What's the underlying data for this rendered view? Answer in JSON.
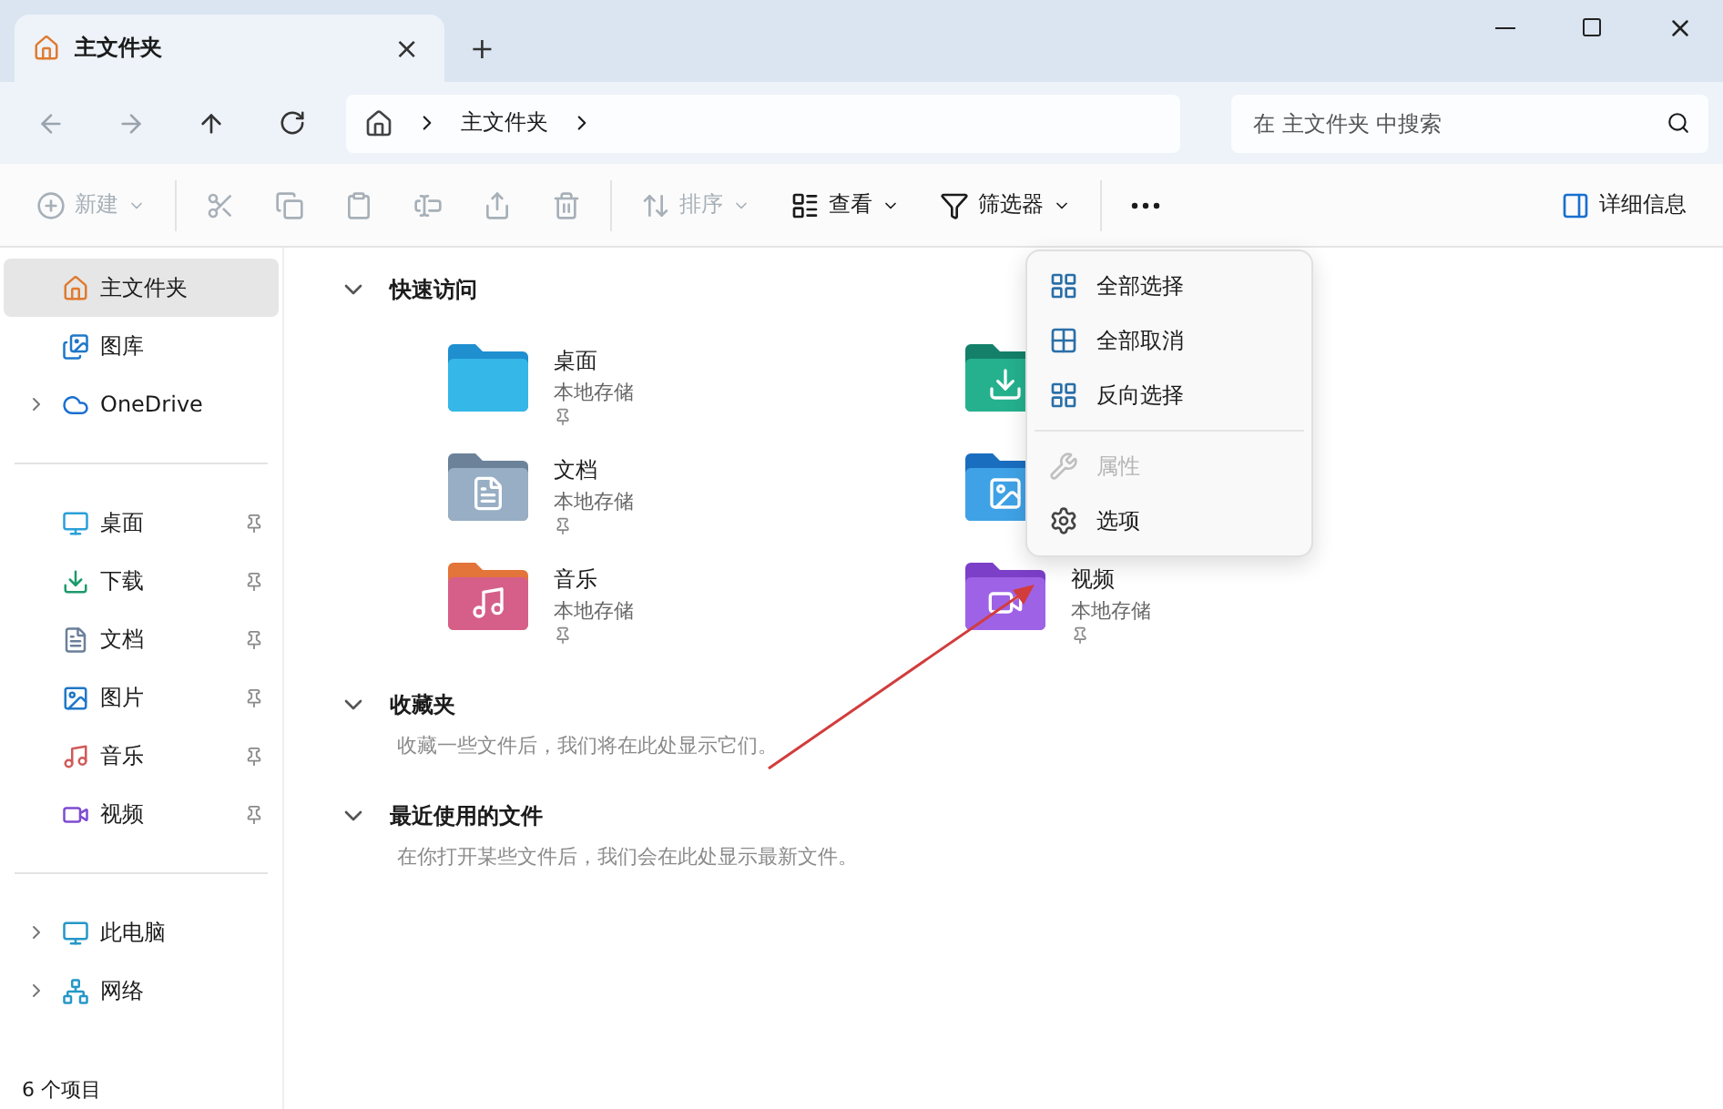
{
  "tab": {
    "title": "主文件夹",
    "close": "×",
    "new": "+"
  },
  "window_controls": [
    {
      "kind": "minimize"
    },
    {
      "kind": "maximize"
    },
    {
      "kind": "close"
    }
  ],
  "nav": {
    "breadcrumb": [
      "主文件夹"
    ],
    "search": {
      "placeholder": "在 主文件夹 中搜索"
    }
  },
  "toolbar": [
    {
      "kind": "new",
      "label": "新建",
      "disabled": true,
      "caret": true
    },
    {
      "kind": "cut",
      "disabled": true
    },
    {
      "kind": "copy",
      "disabled": true
    },
    {
      "kind": "paste",
      "disabled": true
    },
    {
      "kind": "rename",
      "disabled": true
    },
    {
      "kind": "share",
      "disabled": true
    },
    {
      "kind": "delete",
      "disabled": true
    },
    {
      "kind": "sort",
      "label": "排序",
      "disabled": true,
      "caret": true
    },
    {
      "kind": "view",
      "label": "查看",
      "disabled": false,
      "caret": true
    },
    {
      "kind": "filter",
      "label": "筛选器",
      "disabled": false,
      "caret": true
    },
    {
      "kind": "more",
      "disabled": false
    }
  ],
  "details": {
    "label": "详细信息"
  },
  "sidebar": {
    "top": [
      {
        "kind": "home",
        "label": "主文件夹",
        "selected": true,
        "expandable": false
      },
      {
        "kind": "gallery",
        "label": "图库",
        "selected": false,
        "expandable": false
      },
      {
        "kind": "cloud",
        "label": "OneDrive",
        "selected": false,
        "expandable": true
      }
    ],
    "pinned": [
      {
        "kind": "desktop",
        "label": "桌面",
        "selected": false
      },
      {
        "kind": "download",
        "label": "下载",
        "selected": false
      },
      {
        "kind": "docs",
        "label": "文档",
        "selected": false
      },
      {
        "kind": "pictures",
        "label": "图片",
        "selected": false
      },
      {
        "kind": "music",
        "label": "音乐",
        "selected": false
      },
      {
        "kind": "video",
        "label": "视频",
        "selected": false
      }
    ],
    "bottom": [
      {
        "kind": "pc",
        "label": "此电脑",
        "selected": false,
        "expandable": true
      },
      {
        "kind": "network",
        "label": "网络",
        "selected": false,
        "expandable": true
      }
    ]
  },
  "sections": [
    {
      "title": "快速访问",
      "expanded": true,
      "items": [
        {
          "kind": "desktop",
          "name": "桌面",
          "sub": "本地存储"
        },
        {
          "kind": "download"
        },
        {
          "kind": "docs",
          "name": "文档",
          "sub": "本地存储"
        },
        {
          "kind": "pictures"
        },
        {
          "kind": "music",
          "name": "音乐",
          "sub": "本地存储"
        },
        {
          "kind": "video",
          "name": "视频",
          "sub": "本地存储"
        }
      ]
    },
    {
      "title": "收藏夹",
      "expanded": true,
      "hint": "收藏一些文件后，我们将在此处显示它们。"
    },
    {
      "title": "最近使用的文件",
      "expanded": true,
      "hint": "在你打开某些文件后，我们会在此处显示最新文件。"
    }
  ],
  "menu": [
    {
      "kind": "select_all",
      "label": "全部选择",
      "disabled": false
    },
    {
      "kind": "select_none",
      "label": "全部取消",
      "disabled": false
    },
    {
      "kind": "invert",
      "label": "反向选择",
      "disabled": false
    },
    {
      "kind": "divider"
    },
    {
      "kind": "properties",
      "label": "属性",
      "disabled": true
    },
    {
      "kind": "options",
      "label": "选项",
      "disabled": false
    }
  ],
  "status_bar": {
    "count": "6 个项目"
  }
}
